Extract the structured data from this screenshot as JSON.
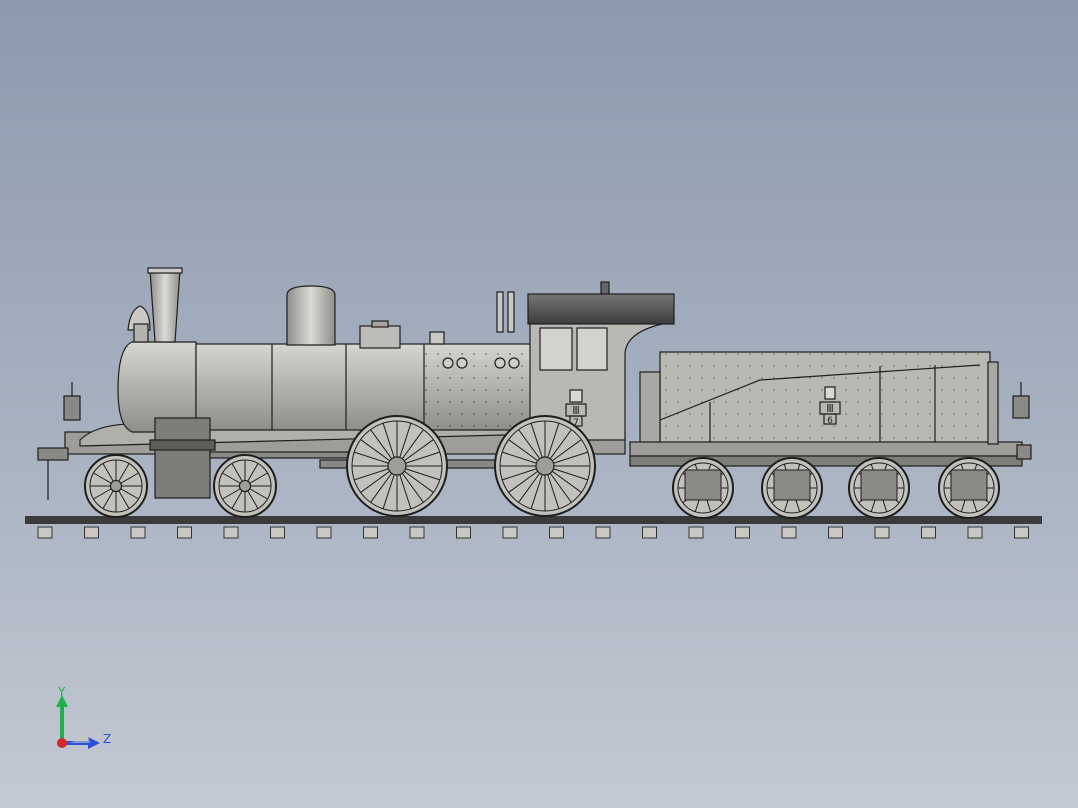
{
  "viewport": {
    "background_top": "#8c9aae",
    "background_bottom": "#c3c9d3"
  },
  "model": {
    "subject": "steam-locomotive-with-tender",
    "body_color": "#b9b8b3",
    "line_color": "#1e1e1e",
    "plates": {
      "loco_letter": "Ⅲ",
      "loco_number": "7",
      "tender_letter": "Ⅲ",
      "tender_number": "6"
    }
  },
  "triad": {
    "y_label": "Y",
    "z_label": "Z",
    "y_color": "#1bb24a",
    "z_color": "#2a4fd8",
    "x_color": "#d8262a"
  }
}
